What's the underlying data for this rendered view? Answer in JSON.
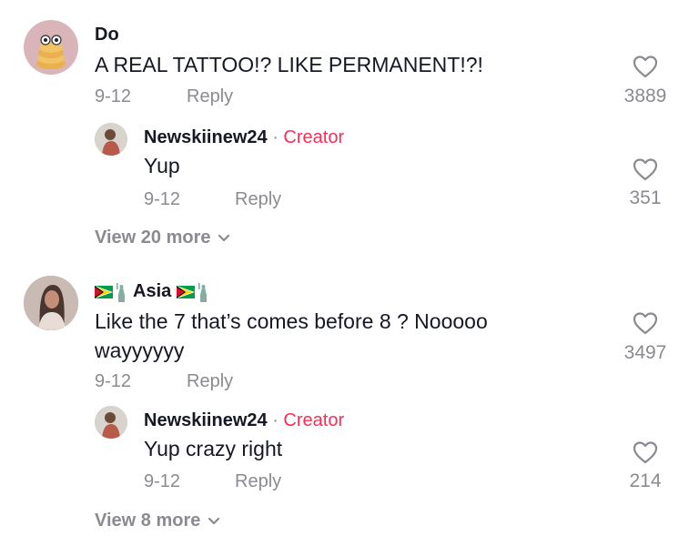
{
  "comments": [
    {
      "username": "Do",
      "text": "A REAL TATTOO!? LIKE PERMANENT!?!",
      "date": "9-12",
      "reply_label": "Reply",
      "likes": "3889",
      "view_more": "View 20 more",
      "replies": [
        {
          "username": "Newskiinew24",
          "separator": "·",
          "creator_label": "Creator",
          "text": "Yup",
          "date": "9-12",
          "reply_label": "Reply",
          "likes": "351"
        }
      ]
    },
    {
      "username": "Asia",
      "username_decorations": [
        "guyana-flag-icon",
        "statue-of-liberty-icon"
      ],
      "text_line1": "Like the 7 that’s comes before 8 ? Nooooo",
      "text_line2": "wayyyyyy",
      "date": "9-12",
      "reply_label": "Reply",
      "likes": "3497",
      "view_more": "View 8 more",
      "replies": [
        {
          "username": "Newskiinew24",
          "separator": "·",
          "creator_label": "Creator",
          "text": "Yup crazy right",
          "date": "9-12",
          "reply_label": "Reply",
          "likes": "214"
        }
      ]
    }
  ],
  "colors": {
    "text": "#161823",
    "muted": "#8a8b91",
    "creator": "#fe2c55",
    "avatar_do_bg": "#d9b4b8"
  }
}
